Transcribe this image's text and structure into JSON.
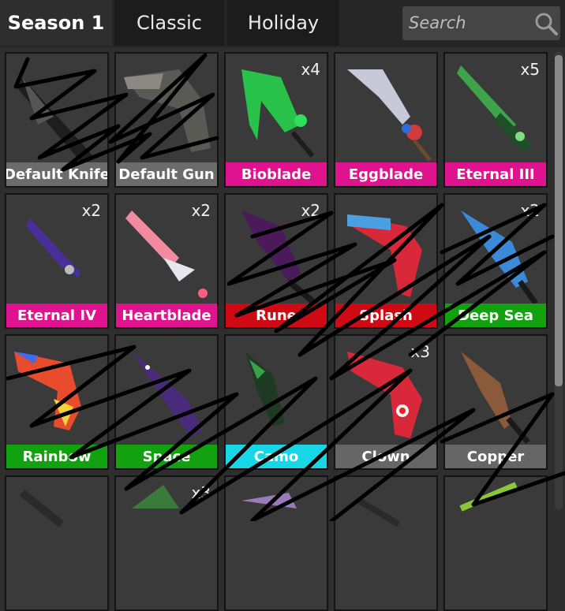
{
  "tabs": [
    {
      "label": "Season 1",
      "active": true
    },
    {
      "label": "Classic",
      "active": false
    },
    {
      "label": "Holiday",
      "active": false
    }
  ],
  "search": {
    "placeholder": "Search",
    "icon": "search-icon"
  },
  "colors": {
    "common": "#6b6b6b",
    "godly": "#e0138f",
    "legendary": "#cf0a14",
    "rare": "#12a20f",
    "vintage": "#17d7e6",
    "uncommon": "#666666"
  },
  "items": [
    {
      "name": "Default Knife",
      "qty": "",
      "rarity": "common"
    },
    {
      "name": "Default Gun",
      "qty": "",
      "rarity": "common"
    },
    {
      "name": "Bioblade",
      "qty": "x4",
      "rarity": "godly"
    },
    {
      "name": "Eggblade",
      "qty": "",
      "rarity": "godly"
    },
    {
      "name": "Eternal III",
      "qty": "x5",
      "rarity": "godly"
    },
    {
      "name": "Eternal IV",
      "qty": "x2",
      "rarity": "godly"
    },
    {
      "name": "Heartblade",
      "qty": "x2",
      "rarity": "godly"
    },
    {
      "name": "Rune",
      "qty": "x2",
      "rarity": "legendary"
    },
    {
      "name": "Splash",
      "qty": "",
      "rarity": "legendary"
    },
    {
      "name": "Deep Sea",
      "qty": "x2",
      "rarity": "rare"
    },
    {
      "name": "Rainbow",
      "qty": "",
      "rarity": "rare"
    },
    {
      "name": "Space",
      "qty": "",
      "rarity": "rare"
    },
    {
      "name": "Camo",
      "qty": "",
      "rarity": "vintage"
    },
    {
      "name": "Clown",
      "qty": "x3",
      "rarity": "uncommon"
    },
    {
      "name": "Copper",
      "qty": "",
      "rarity": "uncommon"
    },
    {
      "name": "",
      "qty": "",
      "rarity": "none"
    },
    {
      "name": "",
      "qty": "x3",
      "rarity": "none"
    },
    {
      "name": "",
      "qty": "",
      "rarity": "none"
    },
    {
      "name": "",
      "qty": "",
      "rarity": "none"
    },
    {
      "name": "",
      "qty": "",
      "rarity": "none"
    }
  ]
}
